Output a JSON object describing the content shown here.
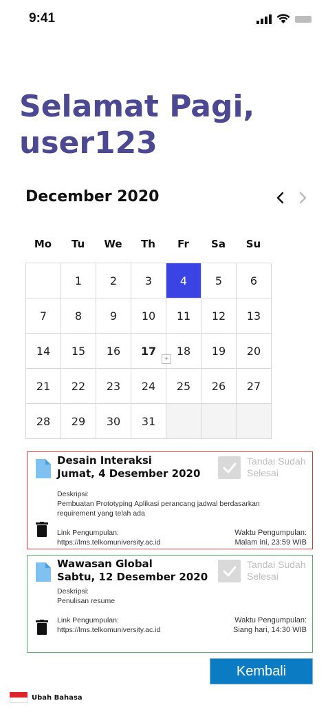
{
  "status_bar": {
    "time": "9:41",
    "icons": [
      "signal-icon",
      "wifi-icon",
      "battery-icon"
    ]
  },
  "greeting": {
    "line1": "Selamat Pagi,",
    "line2": "user123"
  },
  "calendar": {
    "month_title": "December 2020",
    "nav_prev_icon": "chevron-left-icon",
    "nav_next_icon": "chevron-right-icon",
    "weekdays": [
      "Mo",
      "Tu",
      "We",
      "Th",
      "Fr",
      "Sa",
      "Su"
    ],
    "days": [
      "",
      "1",
      "2",
      "3",
      "4",
      "5",
      "6",
      "7",
      "8",
      "9",
      "10",
      "11",
      "12",
      "13",
      "14",
      "15",
      "16",
      "17",
      "18",
      "19",
      "20",
      "21",
      "22",
      "23",
      "24",
      "25",
      "26",
      "27",
      "28",
      "29",
      "30",
      "31",
      "",
      "",
      ""
    ],
    "selected_day": "4",
    "today_day": "17",
    "selected_color": "#3a43e4"
  },
  "tasks": [
    {
      "title": "Desain Interaksi",
      "date": "Jumat, 4 Desember 2020",
      "done_label": "Tandai Sudah Selesai",
      "desc_label": "Deskripsi:",
      "desc_text": "Pembuatan Prototyping Aplikasi perancang jadwal berdasarkan requirement yang telah ada",
      "link_label": "Link Pengumpulan:",
      "link_url": "https://lms.telkomuniversity.ac.id",
      "deadline_label": "Waktu Pengumpulan:",
      "deadline_value": "Malam ini, 23:59 WIB",
      "border_color": "#e23a3a"
    },
    {
      "title": "Wawasan Global",
      "date": "Sabtu, 12 Desember 2020",
      "done_label": "Tandai Sudah Selesai",
      "desc_label": "Deskripsi:",
      "desc_text": "Penulisan resume",
      "link_label": "Link Pengumpulan:",
      "link_url": "https://lms.telkomuniversity.ac.id",
      "deadline_label": "Waktu Pengumpulan:",
      "deadline_value": "Siang hari, 14:30 WIB",
      "border_color": "#5cae6a"
    }
  ],
  "back_button": {
    "label": "Kembali",
    "color": "#0b7bc3"
  },
  "language": {
    "label": "Ubah Bahasa",
    "flag": "indonesia-flag-icon"
  },
  "colors": {
    "greeting": "#4c4892"
  }
}
